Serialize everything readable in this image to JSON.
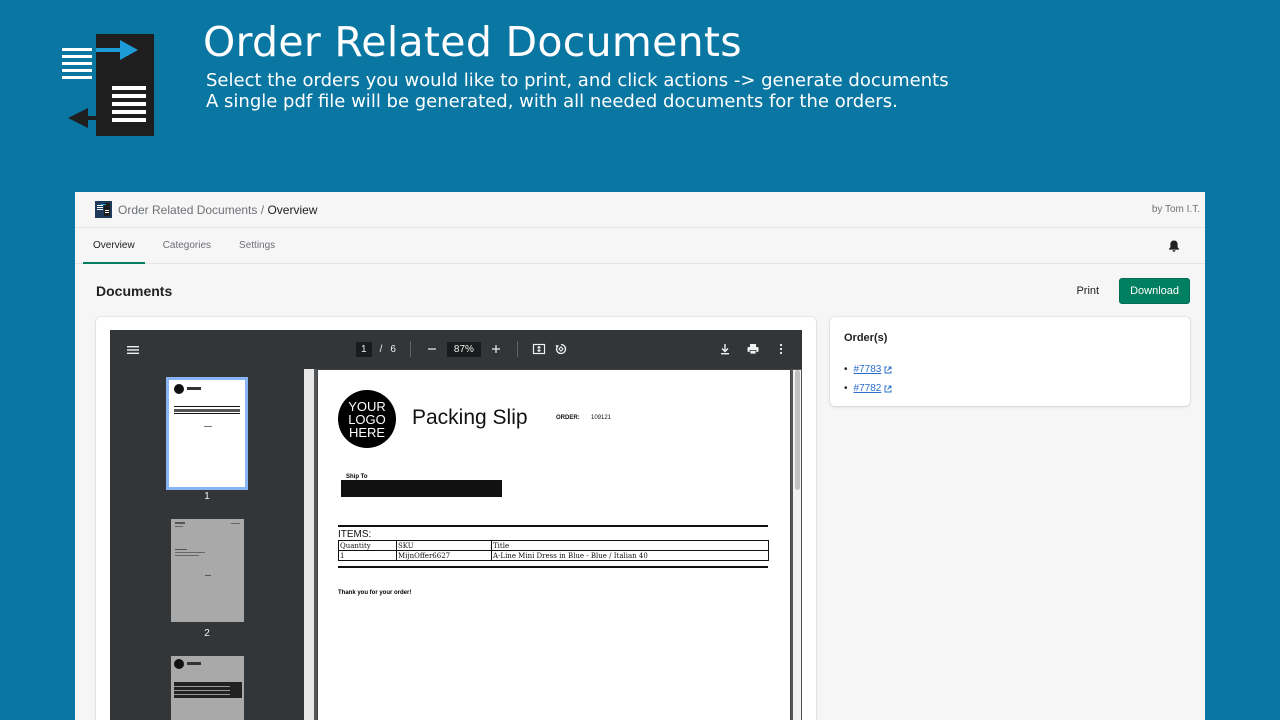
{
  "hero": {
    "title": "Order Related Documents",
    "subtitle_line1": "Select the orders you would like to print, and click actions -> generate documents",
    "subtitle_line2": "A single pdf file will be generated, with all needed documents for the orders."
  },
  "topbar": {
    "app_name": "Order Related Documents",
    "separator": "/",
    "current_page": "Overview",
    "byline": "by Tom I.T."
  },
  "tabs": [
    {
      "label": "Overview",
      "active": true
    },
    {
      "label": "Categories",
      "active": false
    },
    {
      "label": "Settings",
      "active": false
    }
  ],
  "page": {
    "title": "Documents",
    "print_label": "Print",
    "download_label": "Download"
  },
  "viewer": {
    "current_page": "1",
    "page_separator": "/",
    "total_pages": "6",
    "zoom": "87%",
    "thumbnails": [
      {
        "number": "1",
        "selected": true
      },
      {
        "number": "2",
        "selected": false
      }
    ]
  },
  "packing_slip": {
    "logo_lines": [
      "YOUR",
      "LOGO",
      "HERE"
    ],
    "title": "Packing Slip",
    "order_label": "ORDER:",
    "order_number": "109121",
    "ship_to_label": "Ship To",
    "items_label": "ITEMS:",
    "columns": [
      "Quantity",
      "SKU",
      "Title"
    ],
    "rows": [
      [
        "1",
        "MijnOffer6627",
        "A-Line Mini Dress in Blue - Blue / Italian 40"
      ]
    ],
    "thanks": "Thank you for your order!"
  },
  "orders": {
    "title": "Order(s)",
    "items": [
      "#7783",
      "#7782"
    ]
  },
  "colors": {
    "background": "#0a77a3",
    "primary": "#008060",
    "link": "#2c6ecb",
    "viewer_toolbar": "#323639"
  }
}
